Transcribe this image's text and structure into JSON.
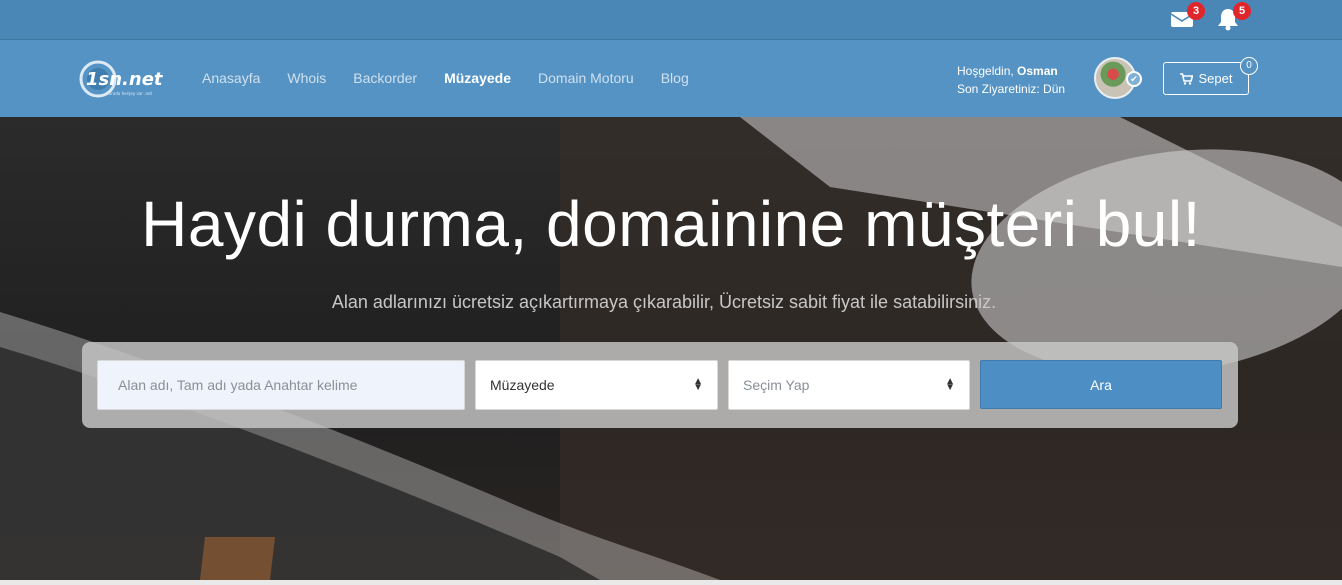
{
  "topbar": {
    "mail_count": "3",
    "notification_count": "5",
    "icons": [
      "envelope-icon",
      "bell-icon"
    ]
  },
  "nav": {
    "logo_text": "1sn.net",
    "logo_tagline": "Burada herşey var .net",
    "links": [
      "Anasayfa",
      "Whois",
      "Backorder",
      "Müzayede",
      "Domain Motoru",
      "Blog"
    ],
    "active": "Müzayede"
  },
  "user": {
    "greeting": "Hoşgeldin,",
    "name": "Osman",
    "last_visit": "Son Ziyaretiniz: Dün"
  },
  "cart": {
    "label": "Sepet",
    "count": "0"
  },
  "hero": {
    "title": "Haydi durma, domainine müşteri bul!",
    "subtitle": "Alan adlarınızı ücretsiz açıkartırmaya çıkarabilir, Ücretsiz sabit fiyat ile satabilirsiniz."
  },
  "search": {
    "placeholder": "Alan adı, Tam adı yada Anahtar kelime",
    "type_selected": "Müzayede",
    "filter_selected": "Seçim Yap",
    "button_label": "Ara"
  },
  "colors": {
    "topbar": "#4a87b6",
    "navbar": "#5593c4",
    "button": "#4d8fc4",
    "badge": "#e0262b"
  }
}
